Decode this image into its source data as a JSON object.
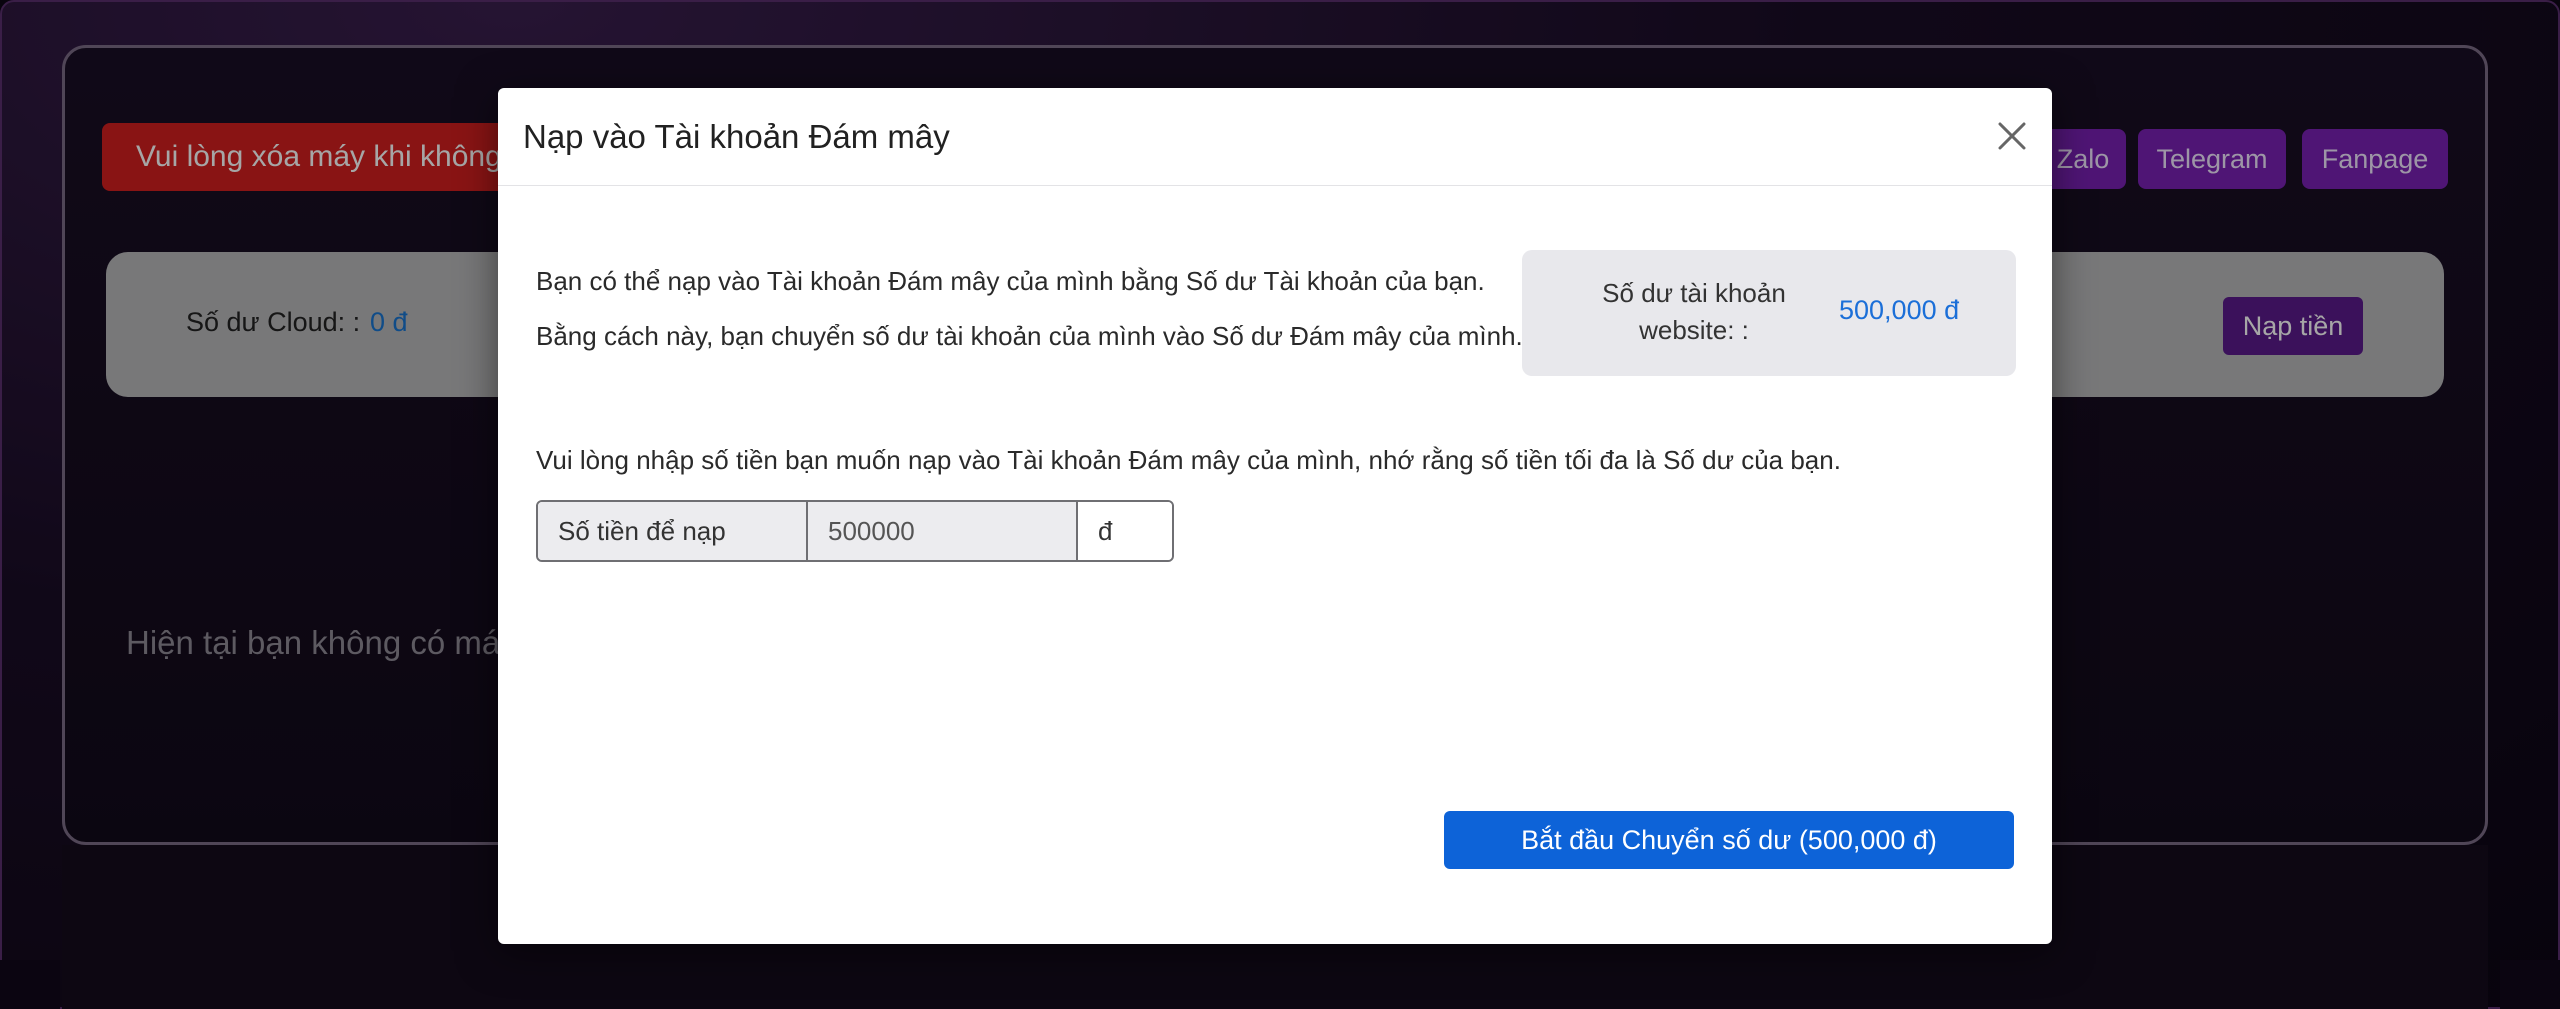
{
  "background": {
    "warning_banner": "Vui lòng xóa máy khi không",
    "social_buttons": [
      "Zalo",
      "Telegram",
      "Fanpage"
    ],
    "cloud_balance_label": "Số dư Cloud: :",
    "cloud_balance_value": "0 đ",
    "topup_button": "Nạp tiền",
    "empty_message": "Hiện tại bạn không có máy"
  },
  "modal": {
    "title": "Nạp vào Tài khoản Đám mây",
    "intro_line_1": "Bạn có thể nạp vào Tài khoản Đám mây của mình bằng Số dư Tài khoản của bạn.",
    "intro_line_2": "Bằng cách này, bạn chuyển số dư tài khoản của mình vào Số dư Đám mây của mình.",
    "website_balance_label": "Số dư tài khoản website: :",
    "website_balance_value": "500,000 đ",
    "instruction": "Vui lòng nhập số tiền bạn muốn nạp vào Tài khoản Đám mây của mình, nhớ rằng số tiền tối đa là Số dư của bạn.",
    "amount_label": "Số tiền để nạp",
    "amount_value": "500000",
    "amount_currency": "đ",
    "submit_button": "Bắt đầu Chuyển số dư (500,000 đ)"
  },
  "icons": {
    "close": "close-icon"
  },
  "colors": {
    "accent_blue": "#0d63d8",
    "warning_red": "#d31f1f",
    "social_purple": "#7a21b4",
    "balance_blue": "#1b6fd8"
  }
}
